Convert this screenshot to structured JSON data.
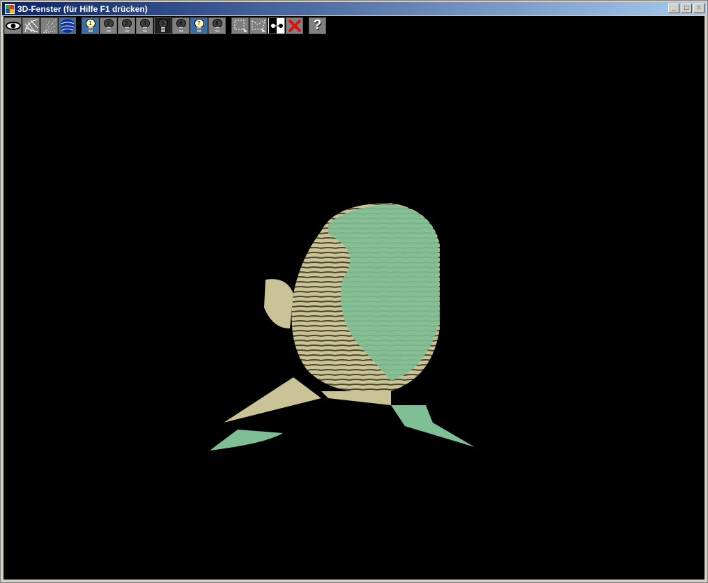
{
  "window": {
    "title": "3D-Fenster (für Hilfe F1 drücken)",
    "minimize": "_",
    "maximize": "□",
    "close": "✕"
  },
  "toolbar": {
    "view_buttons": [
      {
        "icon": "eye-icon"
      },
      {
        "icon": "wireframe-icon"
      },
      {
        "icon": "points-icon"
      },
      {
        "icon": "shaded-sphere-icon",
        "active": true
      }
    ],
    "lights": [
      {
        "label": "1",
        "on": true,
        "active": true
      },
      {
        "label": "2"
      },
      {
        "label": "3"
      },
      {
        "label": "4"
      },
      {
        "label": "5",
        "pressed": true
      },
      {
        "label": "6"
      },
      {
        "label": "7",
        "on": true,
        "active": true
      },
      {
        "label": "8"
      }
    ],
    "tools": [
      {
        "icon": "select-rectangle-icon"
      },
      {
        "icon": "select-polygon-icon"
      },
      {
        "icon": "swap-icon"
      },
      {
        "icon": "delete-icon"
      }
    ],
    "help": "?"
  },
  "colors": {
    "mesh_green": "#7fbf95",
    "mesh_tan": "#c9c396",
    "background": "#000000"
  }
}
